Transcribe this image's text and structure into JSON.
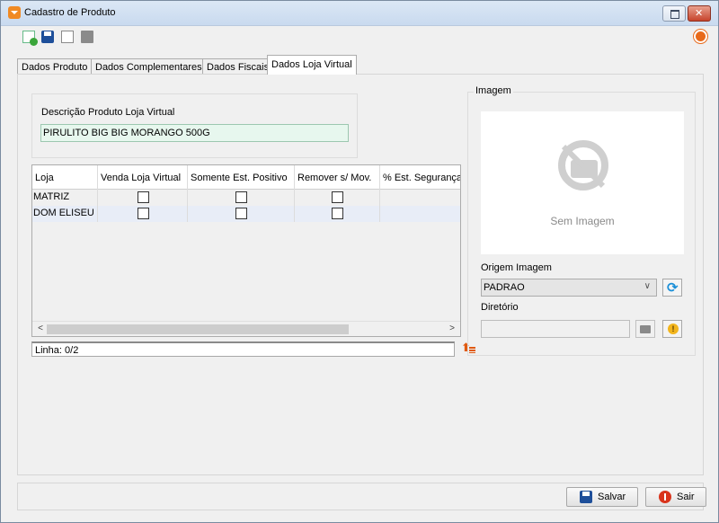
{
  "window": {
    "title": "Cadastro de Produto"
  },
  "toolbar": {
    "icons": [
      "new-document-icon",
      "save-icon",
      "copy-icon",
      "delete-icon"
    ],
    "help_icon": "power-help-icon"
  },
  "tabs": [
    {
      "label": "Dados Produto"
    },
    {
      "label": "Dados Complementares"
    },
    {
      "label": "Dados Fiscais"
    },
    {
      "label": "Dados Loja Virtual"
    }
  ],
  "active_tab": "Dados Loja Virtual",
  "description": {
    "label": "Descrição Produto Loja Virtual",
    "value": "PIRULITO BIG BIG MORANGO 500G"
  },
  "grid": {
    "columns": [
      "Loja",
      "Venda Loja Virtual",
      "Somente Est. Positivo",
      "Remover s/ Mov.",
      "% Est. Segurança"
    ],
    "rows": [
      {
        "loja": "MATRIZ",
        "venda_loja_virtual": false,
        "somente_est_positivo": false,
        "remover_sem_mov": false,
        "est_seguranca": ""
      },
      {
        "loja": "DOM ELISEU",
        "venda_loja_virtual": false,
        "somente_est_positivo": false,
        "remover_sem_mov": false,
        "est_seguranca": ""
      }
    ],
    "scroll_left": "<",
    "scroll_right": ">"
  },
  "status": {
    "linha": "Linha: 0/2"
  },
  "image_group": {
    "title": "Imagem",
    "placeholder_text": "Sem Imagem",
    "origem_label": "Origem Imagem",
    "origem_value": "PADRAO",
    "diretorio_label": "Diretório",
    "diretorio_value": ""
  },
  "footer": {
    "save_label": "Salvar",
    "exit_label": "Sair"
  },
  "colors": {
    "description_input_bg": "#e7f7ee",
    "accent_orange": "#e86a1b",
    "titlebar": "#c9daef"
  }
}
